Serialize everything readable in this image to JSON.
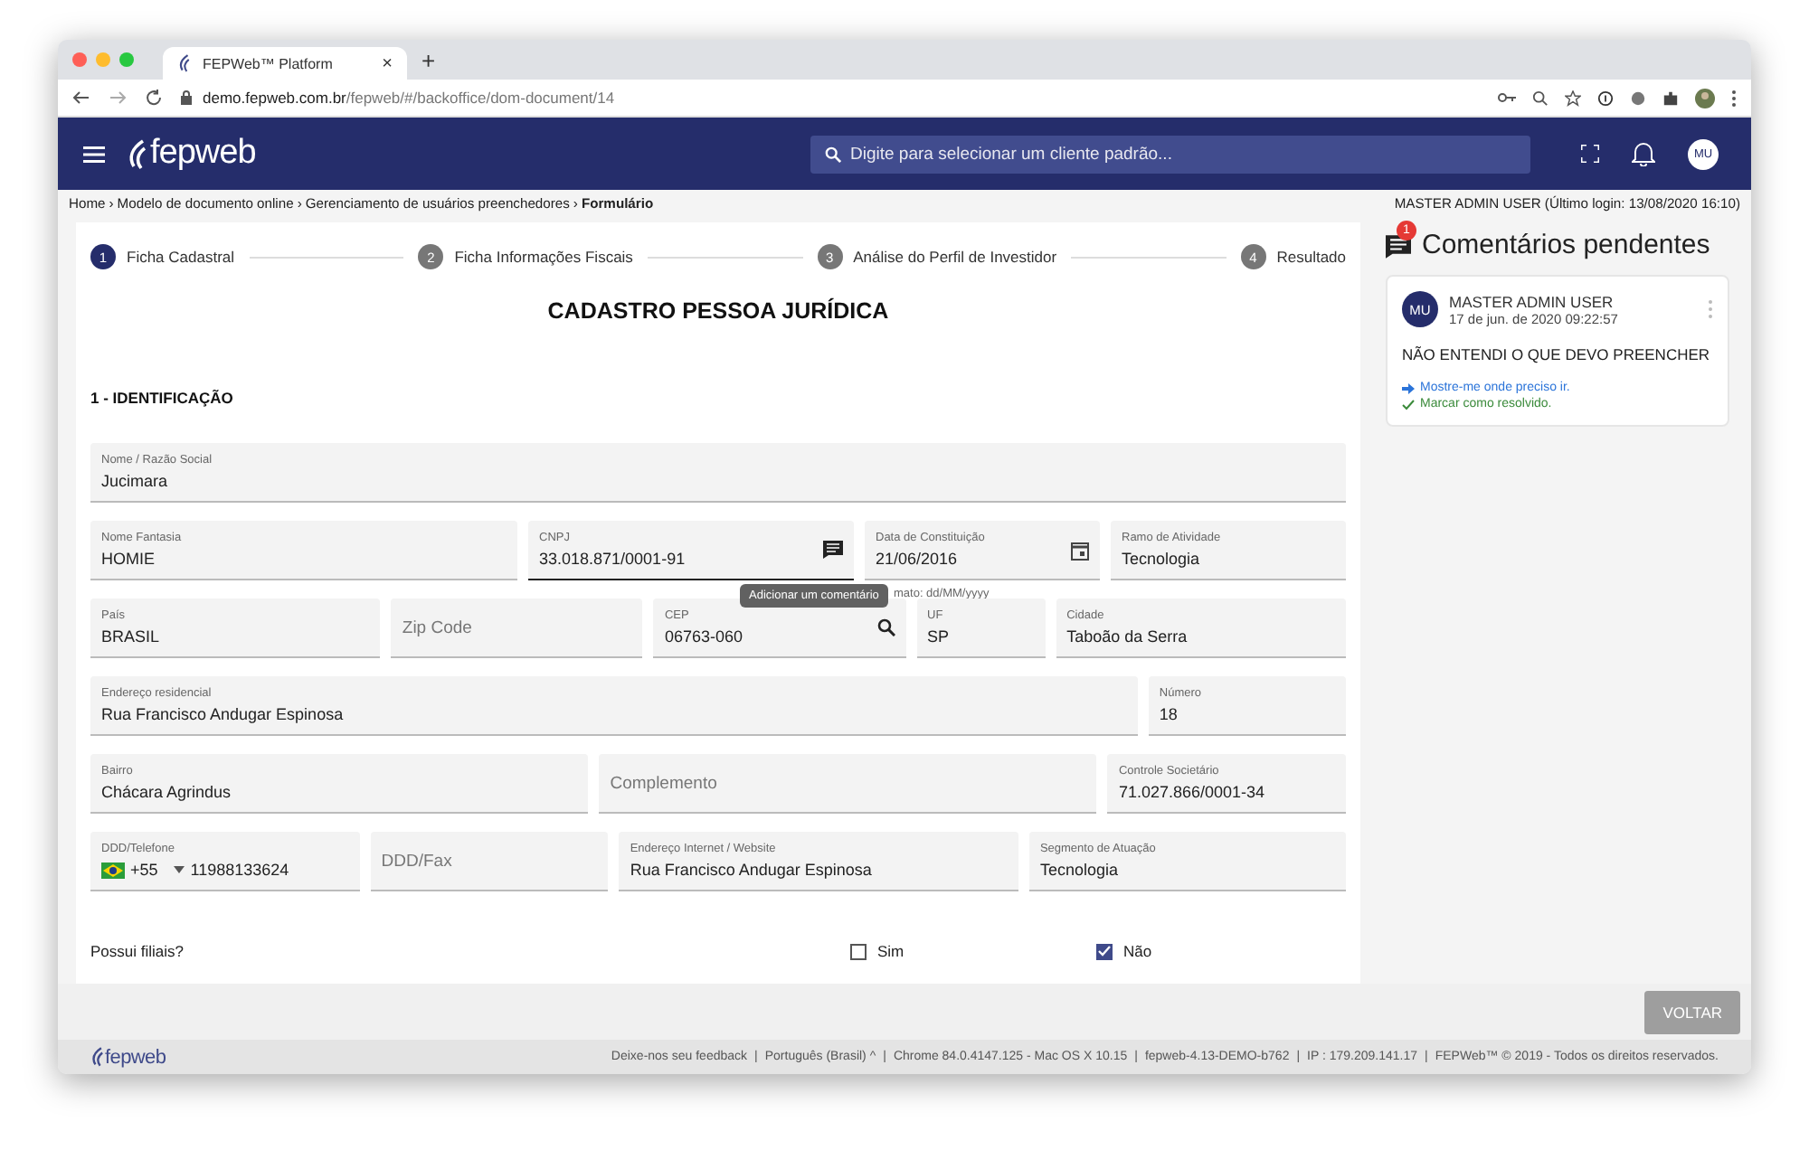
{
  "browser": {
    "tab_title": "FEPWeb™ Platform",
    "tab_close": "×",
    "new_tab": "+",
    "url_host": "demo.fepweb.com.br",
    "url_path": "/fepweb/#/backoffice/dom-document/14"
  },
  "header": {
    "logo": "fepweb",
    "search": {
      "placeholder": "Digite para selecionar um cliente padrão..."
    },
    "avatar": "MU"
  },
  "breadcrumb": {
    "separator": "›",
    "items": [
      {
        "label": "Home",
        "current": false
      },
      {
        "label": "Modelo de documento online",
        "current": false
      },
      {
        "label": "Gerenciamento de usuários preenchedores",
        "current": false
      },
      {
        "label": "Formulário",
        "current": true
      }
    ],
    "user_info": "MASTER ADMIN USER (Último login: 13/08/2020 16:10)"
  },
  "stepper": [
    {
      "number": "1",
      "label": "Ficha Cadastral",
      "selected": true
    },
    {
      "number": "2",
      "label": "Ficha Informações Fiscais",
      "selected": false
    },
    {
      "number": "3",
      "label": "Análise do Perfil de Investidor",
      "selected": false
    },
    {
      "number": "4",
      "label": "Resultado",
      "selected": false
    }
  ],
  "form": {
    "title": "CADASTRO PESSOA JURÍDICA",
    "section": "1 - IDENTIFICAÇÃO",
    "fields": [
      {
        "kind": "text",
        "label": "Nome / Razão Social",
        "value": "Jucimara",
        "focused": false
      },
      {
        "kind": "text",
        "label": "Nome Fantasia",
        "value": "HOMIE",
        "focused": false
      },
      {
        "kind": "comment",
        "label": "CNPJ",
        "value": "33.018.871/0001-91",
        "focused": true
      },
      {
        "kind": "date",
        "label": "Data de Constituição",
        "value": "21/06/2016",
        "focused": false,
        "hint": "mato: dd/MM/yyyy"
      },
      {
        "kind": "text",
        "label": "Ramo de Atividade",
        "value": "Tecnologia",
        "focused": false
      },
      {
        "kind": "text",
        "label": "País",
        "value": "BRASIL",
        "focused": false
      },
      {
        "kind": "text",
        "placeholder": "Zip Code",
        "focused": false
      },
      {
        "kind": "search",
        "label": "CEP",
        "value": "06763-060",
        "focused": false
      },
      {
        "kind": "text",
        "label": "UF",
        "value": "SP",
        "focused": false
      },
      {
        "kind": "text",
        "label": "Cidade",
        "value": "Taboão da Serra",
        "focused": false
      },
      {
        "kind": "text",
        "label": "Endereço residencial",
        "value": "Rua Francisco Andugar Espinosa",
        "focused": false
      },
      {
        "kind": "text",
        "label": "Número",
        "value": "18",
        "focused": false
      },
      {
        "kind": "text",
        "label": "Bairro",
        "value": "Chácara Agrindus",
        "focused": false
      },
      {
        "kind": "text",
        "placeholder": "Complemento",
        "focused": false
      },
      {
        "kind": "text",
        "label": "Controle Societário",
        "value": "71.027.866/0001-34",
        "focused": false
      },
      {
        "kind": "phone",
        "label": "DDD/Telefone",
        "country_code": "+55",
        "value": "11988133624",
        "focused": false
      },
      {
        "kind": "text",
        "placeholder": "DDD/Fax",
        "focused": false
      },
      {
        "kind": "text",
        "label": "Endereço Internet / Website",
        "value": "Rua Francisco Andugar Espinosa",
        "focused": false
      },
      {
        "kind": "text",
        "label": "Segmento de Atuação",
        "value": "Tecnologia",
        "focused": false
      }
    ],
    "tooltip": "Adicionar um comentário",
    "question": {
      "label": "Possui filiais?",
      "options": [
        {
          "label": "Sim",
          "checked": false
        },
        {
          "label": "Não",
          "checked": true
        }
      ]
    }
  },
  "comments": {
    "title": "Comentários pendentes",
    "count": "1",
    "items": [
      {
        "avatar": "MU",
        "author": "MASTER ADMIN USER",
        "date": "17 de jun. de 2020 09:22:57",
        "text": "NÃO ENTENDI O QUE DEVO PREENCHER",
        "go_link": "Mostre-me onde preciso ir.",
        "resolve_link": "Marcar como resolvido."
      }
    ]
  },
  "back_button": "VOLTAR",
  "footer": {
    "logo": "fepweb",
    "separator": "|",
    "items": [
      "Deixe-nos seu feedback",
      "Português (Brasil) ^",
      "Chrome 84.0.4147.125 - Mac OS X 10.15",
      "fepweb-4.13-DEMO-b762",
      "IP : 179.209.141.17",
      "FEPWeb™ © 2019 - Todos os direitos reservados."
    ]
  }
}
